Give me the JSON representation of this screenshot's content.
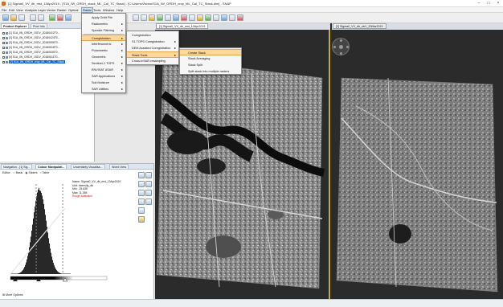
{
  "window": {
    "title": "[1] Sigma0_VV_db_mst_13Apr2019 - [S1A_IW_GRDH_stack_ML_Cal_TC_Stack] - [C:\\Users\\Vishnu\\S1A_IW_GRDH_crop_ML_Cal_TC_Stack.dim] - SNAP"
  },
  "menubar": {
    "items": [
      "File",
      "Edit",
      "View",
      "Analysis",
      "Layer",
      "Vector",
      "Raster",
      "Optical",
      "Radar",
      "Tools",
      "Window",
      "Help"
    ],
    "active": "Radar"
  },
  "product_explorer": {
    "tabs": [
      "Product Explorer",
      "Pixel Info"
    ],
    "products": [
      "[1] S1A_IW_GRDH_1SDV_20180412T0...",
      "[2] S1A_IW_GRDH_1SDV_20180424T0...",
      "[3] S1A_IW_GRDH_1SDV_20180506T0...",
      "[4] S1A_IW_GRDH_1SDV_20180518T0...",
      "[5] S1A_IW_GRDH_1SDV_20180530T0...",
      "[6] S1A_IW_GRDH_1SDV_20180611T0...",
      "[7] S1A_IW_GRDH_crop_ML_Cal_TC_Stack"
    ]
  },
  "radar_menu": {
    "items": [
      {
        "label": "Apply Orbit File",
        "arrow": false
      },
      {
        "label": "Radiometric",
        "arrow": true
      },
      {
        "label": "Speckle Filtering",
        "arrow": true
      },
      {
        "label": "Coregistration",
        "arrow": true
      },
      {
        "label": "Interferometric",
        "arrow": true
      },
      {
        "label": "Polarimetric",
        "arrow": true
      },
      {
        "label": "Geometric",
        "arrow": true
      },
      {
        "label": "Sentinel-1 TOPS",
        "arrow": true
      },
      {
        "label": "ENVISAT ASAR",
        "arrow": true
      },
      {
        "label": "SAR Applications",
        "arrow": true
      },
      {
        "label": "Soil Moisture",
        "arrow": true
      },
      {
        "label": "SAR Utilities",
        "arrow": true
      }
    ],
    "highlighted": "Coregistration"
  },
  "coregistration_menu": {
    "items": [
      {
        "label": "Coregistration",
        "arrow": false
      },
      {
        "label": "S1 TOPS Coregistration",
        "arrow": true
      },
      {
        "label": "DEM Assisted Coregistration",
        "arrow": true
      },
      {
        "label": "Stack Tools",
        "arrow": true
      },
      {
        "label": "Cross-InSAR resampling",
        "arrow": false
      }
    ],
    "highlighted": "Stack Tools"
  },
  "stack_tools_menu": {
    "items": [
      "Create Stack",
      "Stack Averaging",
      "Stack Split",
      "Split stack into multiple rasters"
    ],
    "highlighted": "Create Stack"
  },
  "image_views": {
    "tabs": [
      "[1] Sigma0_VV_db_mst_13Apr2019",
      "[2] Sigma0_VV_db_slv1_20Mar2019"
    ]
  },
  "colour_manipulation": {
    "tabs": [
      "Navigation - [1] Sig...",
      "Colour Manipulati...",
      "Uncertainty Visualisa...",
      "World View"
    ],
    "editor_label": "Editor:",
    "editor_options": [
      "Basic",
      "Sliders",
      "Table"
    ],
    "editor_selected": "Sliders",
    "info": [
      "Name: Sigma0_VV_db_mst_13Apr2019",
      "Unit: intensity_db",
      "Min: -25.835",
      "Max: 11.355"
    ],
    "rough_stats": "Rough statistics!",
    "more_options": "More Options",
    "histogram_color": "#111111",
    "accent": "#ff0000"
  }
}
